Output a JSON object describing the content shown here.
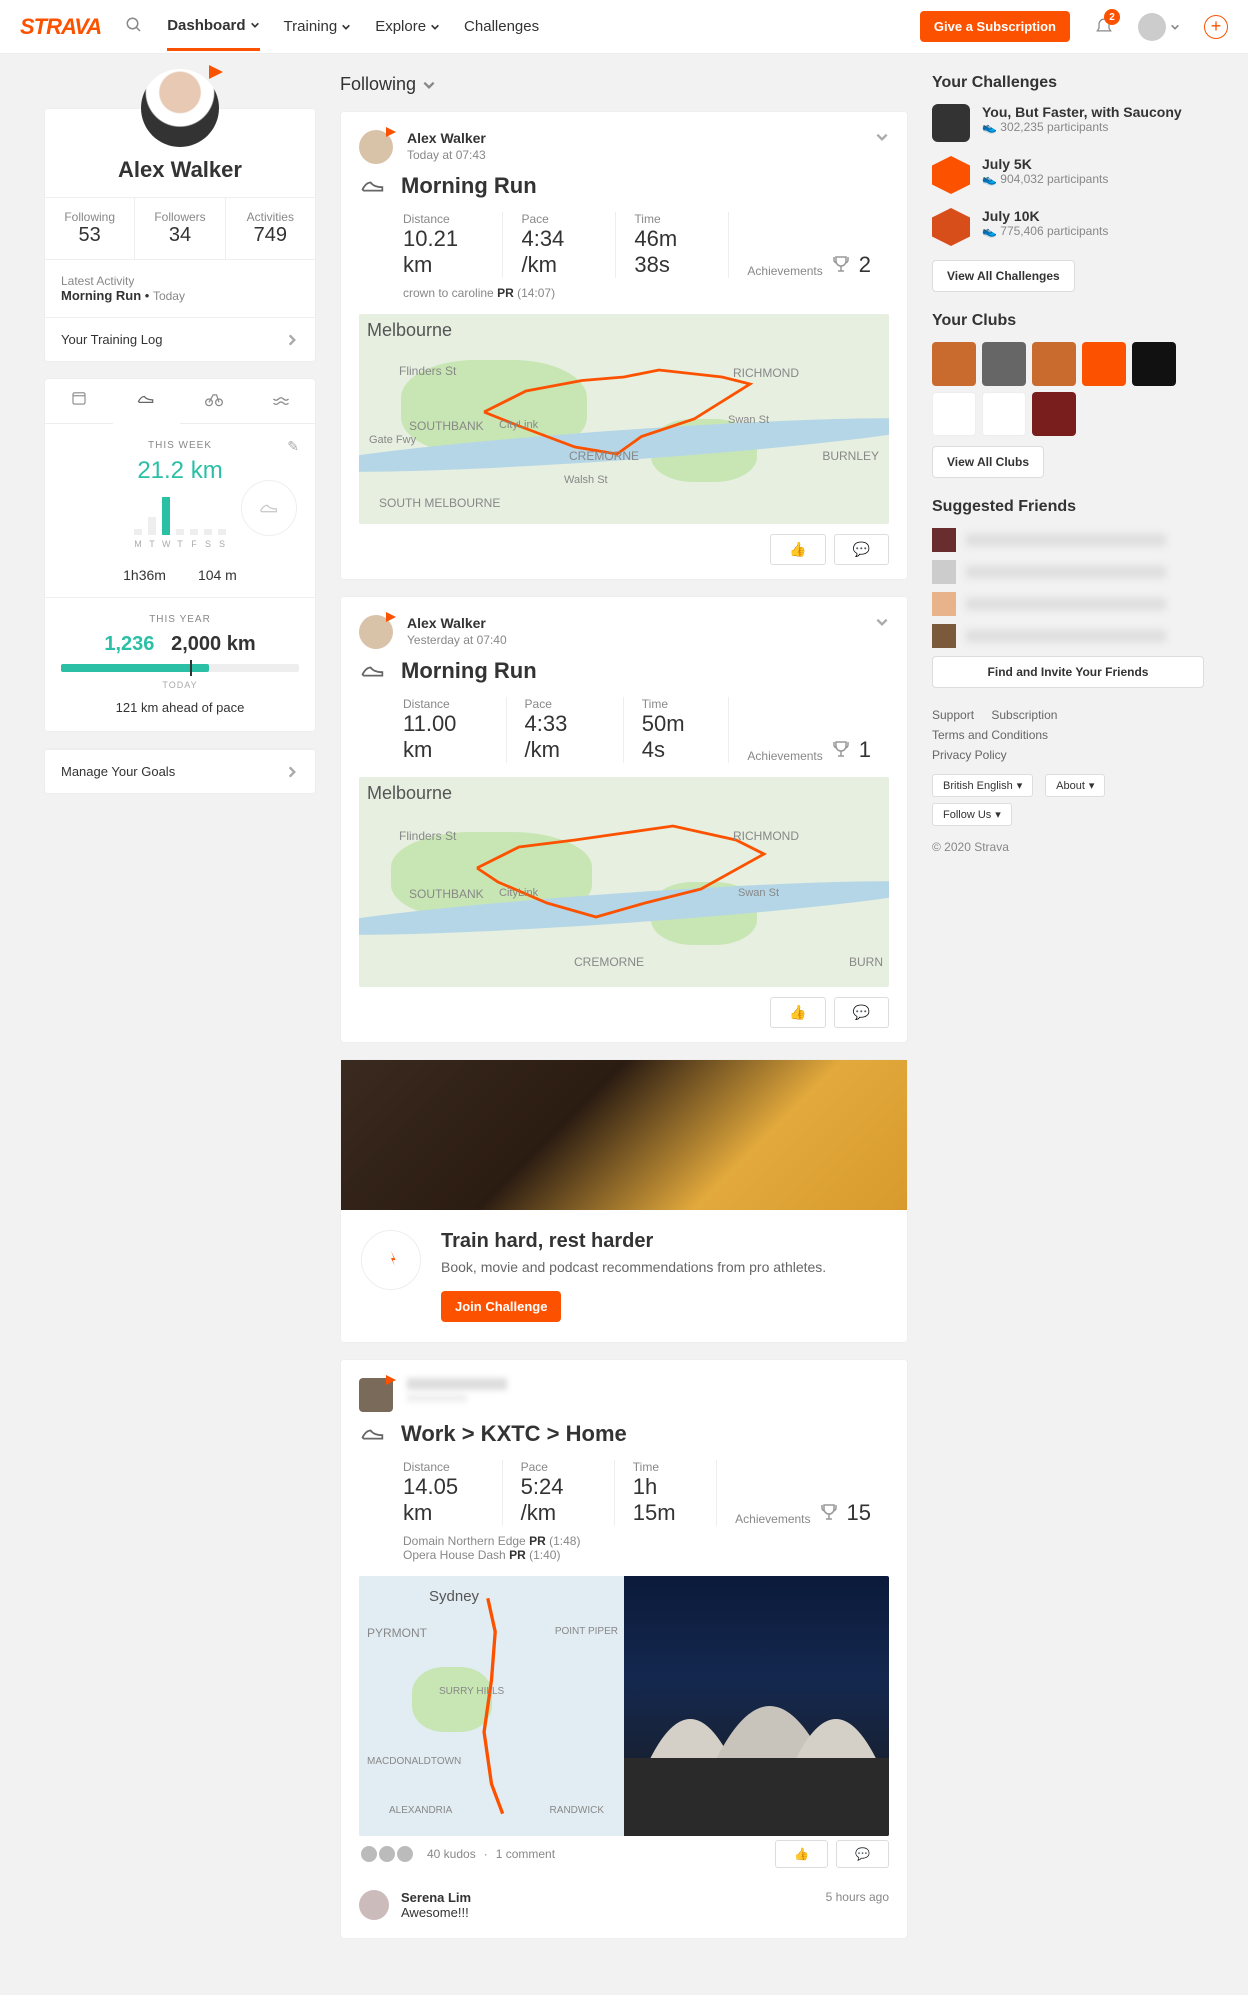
{
  "nav": {
    "brand": "STRAVA",
    "items": [
      "Dashboard",
      "Training",
      "Explore",
      "Challenges"
    ],
    "give": "Give a Subscription",
    "notif_count": "2"
  },
  "profile": {
    "name": "Alex Walker",
    "stats": [
      {
        "label": "Following",
        "value": "53"
      },
      {
        "label": "Followers",
        "value": "34"
      },
      {
        "label": "Activities",
        "value": "749"
      }
    ],
    "latest_label": "Latest Activity",
    "latest_value": "Morning Run",
    "latest_when": "Today",
    "training_log": "Your Training Log",
    "week_label": "THIS WEEK",
    "week_dist": "21.2 km",
    "week_time": "1h36m",
    "week_elev": "104 m",
    "year_label": "THIS YEAR",
    "year_cur": "1,236",
    "year_goal": "2,000 km",
    "today_marker": "TODAY",
    "pace": "121 km ahead of pace",
    "goals_link": "Manage Your Goals"
  },
  "feed_tab": "Following",
  "activities": [
    {
      "user": "Alex Walker",
      "when": "Today at 07:43",
      "title": "Morning Run",
      "metrics": {
        "Distance": "10.21 km",
        "Pace": "4:34 /km",
        "Time": "46m 38s",
        "Achievements": "2"
      },
      "seg1": "crown to caroline",
      "seg1t": "(14:07)",
      "city": "Melbourne",
      "labels": [
        "Flinders St",
        "RICHMOND",
        "SOUTHBANK",
        "CityLink",
        "Swan St",
        "CREMORNE",
        "BURNLEY",
        "SOUTH MELBOURNE",
        "Gate Fwy",
        "Walsh St"
      ]
    },
    {
      "user": "Alex Walker",
      "when": "Yesterday at 07:40",
      "title": "Morning Run",
      "metrics": {
        "Distance": "11.00 km",
        "Pace": "4:33 /km",
        "Time": "50m 4s",
        "Achievements": "1"
      },
      "city": "Melbourne",
      "labels": [
        "Flinders St",
        "RICHMOND",
        "SOUTHBANK",
        "CityLink",
        "Swan St",
        "CREMORNE",
        "BURN"
      ]
    },
    {
      "user": "—",
      "when": "",
      "title": "Work > KXTC > Home",
      "metrics": {
        "Distance": "14.05 km",
        "Pace": "5:24 /km",
        "Time": "1h 15m",
        "Achievements": "15"
      },
      "seg1": "Domain Northern Edge",
      "seg1t": "(1:48)",
      "seg2": "Opera House Dash",
      "seg2t": "(1:40)",
      "city": "Sydney",
      "labels": [
        "PYRMONT",
        "POINT PIPER",
        "SURRY HILLS",
        "MACDONALDTOWN",
        "ALEXANDRIA",
        "RANDWICK"
      ],
      "kudos": "40 kudos",
      "comments_count": "1 comment",
      "commenter": "Serena Lim",
      "comment": "Awesome!!!",
      "comment_time": "5 hours ago"
    }
  ],
  "promo": {
    "title": "Train hard, rest harder",
    "text": "Book, movie and podcast recommendations from pro athletes.",
    "cta": "Join Challenge"
  },
  "right": {
    "challenges_h": "Your Challenges",
    "challenges": [
      {
        "title": "You, But Faster, with Saucony",
        "p": "302,235 participants"
      },
      {
        "title": "July 5K",
        "p": "904,032 participants"
      },
      {
        "title": "July 10K",
        "p": "775,406 participants"
      }
    ],
    "view_challenges": "View All Challenges",
    "clubs_h": "Your Clubs",
    "view_clubs": "View All Clubs",
    "suggested_h": "Suggested Friends",
    "find_friends": "Find and Invite Your Friends",
    "footer": [
      "Support",
      "Subscription",
      "Terms and Conditions",
      "Privacy Policy"
    ],
    "lang": "British English",
    "about": "About",
    "follow": "Follow Us",
    "copyright": "© 2020 Strava"
  }
}
